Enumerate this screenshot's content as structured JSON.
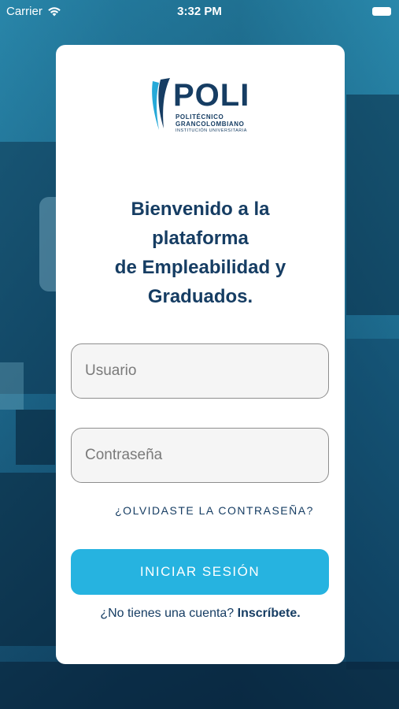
{
  "status_bar": {
    "carrier": "Carrier",
    "time": "3:32 PM"
  },
  "logo": {
    "word": "POLI",
    "line1": "POLITÉCNICO",
    "line2": "GRANCOLOMBIANO",
    "line3": "INSTITUCIÓN UNIVERSITARIA"
  },
  "welcome": {
    "line1": "Bienvenido a la",
    "line2": "plataforma",
    "line3": "de Empleabilidad y",
    "line4": "Graduados."
  },
  "form": {
    "username_placeholder": "Usuario",
    "password_placeholder": "Contraseña",
    "forgot_label": "¿OLVIDASTE LA CONTRASEÑA?",
    "login_label": "INICIAR SESIÓN",
    "signup_prompt": "¿No tienes una cuenta?",
    "signup_link": "Inscríbete."
  },
  "colors": {
    "brand_dark": "#163d63",
    "accent": "#26b3e0"
  }
}
